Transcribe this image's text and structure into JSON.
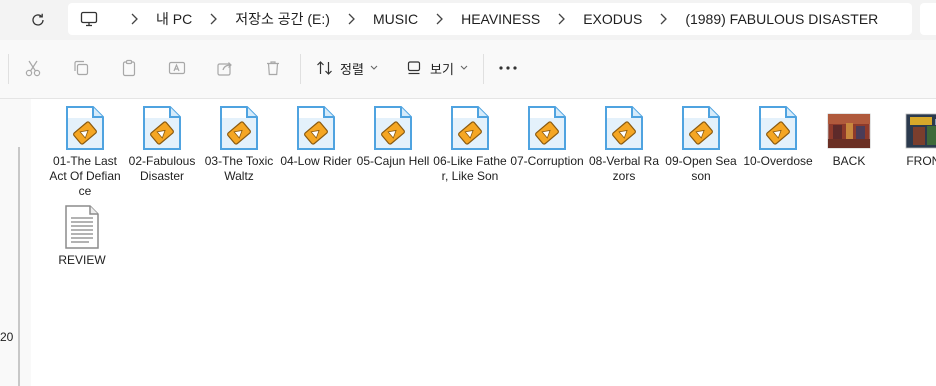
{
  "address": {
    "crumbs": [
      "내 PC",
      "저장소 공간 (E:)",
      "MUSIC",
      "HEAVINESS",
      "EXODUS",
      "(1989) FABULOUS DISASTER"
    ]
  },
  "toolbar": {
    "sort_label": "정렬",
    "view_label": "보기"
  },
  "nav": {
    "partial_text": "20"
  },
  "files": [
    {
      "name": "01-The Last Act Of Defiance",
      "type": "audio"
    },
    {
      "name": "02-Fabulous Disaster",
      "type": "audio"
    },
    {
      "name": "03-The Toxic Waltz",
      "type": "audio"
    },
    {
      "name": "04-Low Rider",
      "type": "audio"
    },
    {
      "name": "05-Cajun Hell",
      "type": "audio"
    },
    {
      "name": "06-Like Father, Like Son",
      "type": "audio"
    },
    {
      "name": "07-Corruption",
      "type": "audio"
    },
    {
      "name": "08-Verbal Razors",
      "type": "audio"
    },
    {
      "name": "09-Open Season",
      "type": "audio"
    },
    {
      "name": "10-Overdose",
      "type": "audio"
    },
    {
      "name": "BACK",
      "type": "image"
    },
    {
      "name": "FRONT",
      "type": "image"
    },
    {
      "name": "REVIEW",
      "type": "text"
    }
  ],
  "colors": {
    "window_bg": "#f3f3f3",
    "content_bg": "#ffffff",
    "file_icon_blue": "#4fa3e0",
    "player_orange": "#f5a623"
  }
}
